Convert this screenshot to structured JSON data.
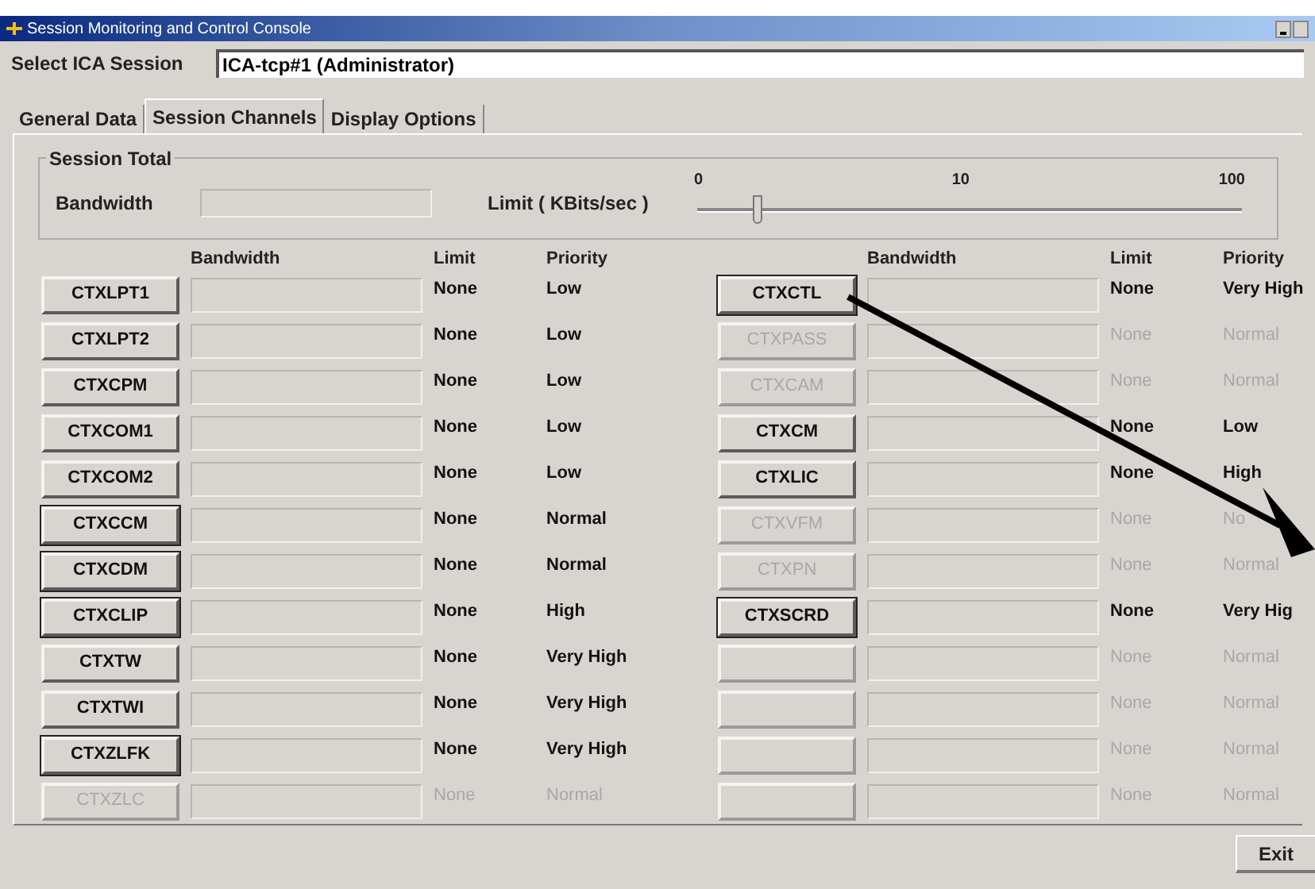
{
  "window": {
    "title": "Session Monitoring and Control Console"
  },
  "session_select": {
    "label": "Select ICA Session",
    "value": "ICA-tcp#1 (Administrator)"
  },
  "tabs": [
    {
      "label": "General Data",
      "selected": false
    },
    {
      "label": "Session Channels",
      "selected": true
    },
    {
      "label": "Display Options",
      "selected": false
    }
  ],
  "session_total": {
    "title": "Session Total",
    "bandwidth_label": "Bandwidth",
    "limit_label": "Limit ( KBits/sec )",
    "slider": {
      "level": 0.11,
      "ticks": [
        "0",
        "10",
        "100"
      ]
    }
  },
  "column_headers": [
    {
      "bandwidth": "Bandwidth",
      "limit": "Limit",
      "priority": "Priority"
    },
    {
      "bandwidth": "Bandwidth",
      "limit": "Limit",
      "priority": "Priority"
    }
  ],
  "channels_left": [
    {
      "name": "CTXLPT1",
      "disabled": false,
      "outlined": false,
      "limit": "None",
      "priority": "Low"
    },
    {
      "name": "CTXLPT2",
      "disabled": false,
      "outlined": false,
      "limit": "None",
      "priority": "Low"
    },
    {
      "name": "CTXCPM",
      "disabled": false,
      "outlined": false,
      "limit": "None",
      "priority": "Low"
    },
    {
      "name": "CTXCOM1",
      "disabled": false,
      "outlined": false,
      "limit": "None",
      "priority": "Low"
    },
    {
      "name": "CTXCOM2",
      "disabled": false,
      "outlined": false,
      "limit": "None",
      "priority": "Low"
    },
    {
      "name": "CTXCCM",
      "disabled": false,
      "outlined": true,
      "limit": "None",
      "priority": "Normal"
    },
    {
      "name": "CTXCDM",
      "disabled": false,
      "outlined": true,
      "limit": "None",
      "priority": "Normal"
    },
    {
      "name": "CTXCLIP",
      "disabled": false,
      "outlined": true,
      "limit": "None",
      "priority": "High"
    },
    {
      "name": "CTXTW",
      "disabled": false,
      "outlined": false,
      "limit": "None",
      "priority": "Very High"
    },
    {
      "name": "CTXTWI",
      "disabled": false,
      "outlined": false,
      "limit": "None",
      "priority": "Very High"
    },
    {
      "name": "CTXZLFK",
      "disabled": false,
      "outlined": true,
      "limit": "None",
      "priority": "Very High"
    },
    {
      "name": "CTXZLC",
      "disabled": true,
      "outlined": false,
      "limit": "None",
      "priority": "Normal"
    }
  ],
  "channels_right": [
    {
      "name": "CTXCTL",
      "disabled": false,
      "outlined": true,
      "limit": "None",
      "priority": "Very High"
    },
    {
      "name": "CTXPASS",
      "disabled": true,
      "outlined": false,
      "limit": "None",
      "priority": "Normal"
    },
    {
      "name": "CTXCAM",
      "disabled": true,
      "outlined": false,
      "limit": "None",
      "priority": "Normal"
    },
    {
      "name": "CTXCM",
      "disabled": false,
      "outlined": false,
      "limit": "None",
      "priority": "Low"
    },
    {
      "name": "CTXLIC",
      "disabled": false,
      "outlined": false,
      "limit": "None",
      "priority": "High"
    },
    {
      "name": "CTXVFM",
      "disabled": true,
      "outlined": false,
      "limit": "None",
      "priority": "No"
    },
    {
      "name": "CTXPN",
      "disabled": true,
      "outlined": false,
      "limit": "None",
      "priority": "Normal"
    },
    {
      "name": "CTXSCRD",
      "disabled": false,
      "outlined": true,
      "limit": "None",
      "priority": "Very Hig"
    },
    {
      "disabled": true,
      "outlined": false,
      "limit": "None",
      "priority": "Normal"
    },
    {
      "disabled": true,
      "outlined": false,
      "limit": "None",
      "priority": "Normal"
    },
    {
      "disabled": true,
      "outlined": false,
      "limit": "None",
      "priority": "Normal"
    },
    {
      "disabled": true,
      "outlined": false,
      "limit": "None",
      "priority": "Normal"
    }
  ],
  "exit_button": "Exit"
}
